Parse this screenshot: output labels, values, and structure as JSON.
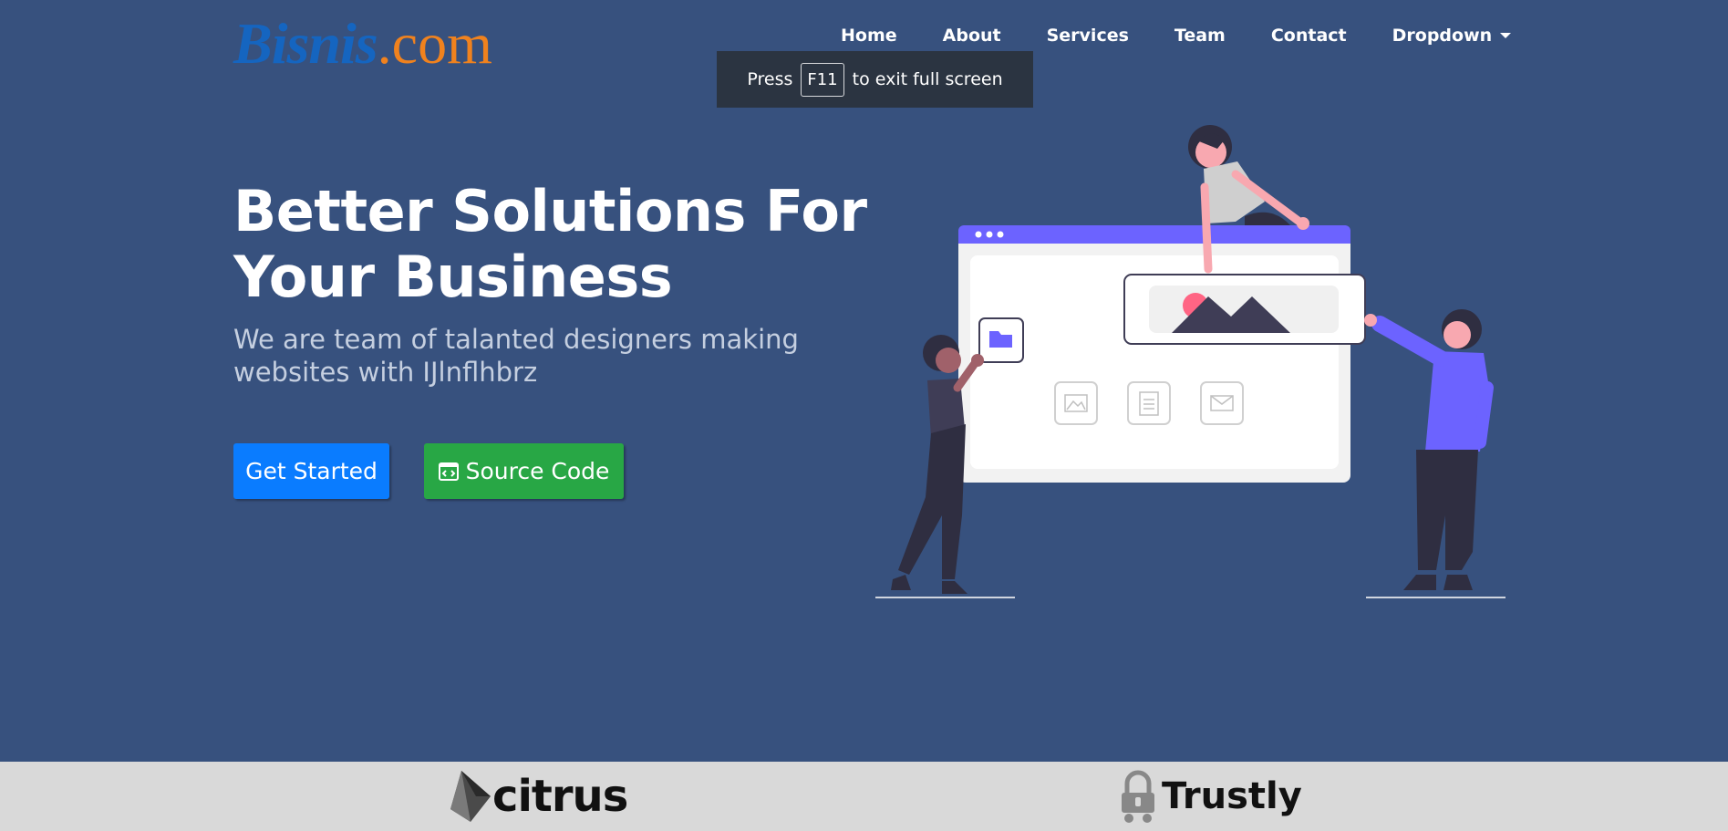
{
  "logo": {
    "brand": "Bisnis",
    "tld": ".com"
  },
  "nav": [
    {
      "label": "Home"
    },
    {
      "label": "About"
    },
    {
      "label": "Services"
    },
    {
      "label": "Team"
    },
    {
      "label": "Contact"
    },
    {
      "label": "Dropdown"
    }
  ],
  "fullscreen_notice": {
    "before": "Press",
    "key": "F11",
    "after": "to exit full screen"
  },
  "hero": {
    "title_line1": "Better Solutions For",
    "title_line2": "Your Business",
    "subtitle": "We are team of talanted designers making websites with IJlnflhbrz",
    "primary_button": "Get Started",
    "secondary_button": "Source Code"
  },
  "partners": [
    {
      "name": "citrus"
    },
    {
      "name": "Trustly"
    }
  ],
  "colors": {
    "background": "#37517e",
    "primary": "#0a7cff",
    "success": "#28a745",
    "accent": "#6c63ff",
    "logo_brand": "#1565c0",
    "logo_tld": "#f0821e"
  },
  "icons": [
    "code-icon",
    "caret-down-icon",
    "folder-icon",
    "image-icon",
    "document-icon",
    "mail-icon",
    "lock-icon"
  ]
}
